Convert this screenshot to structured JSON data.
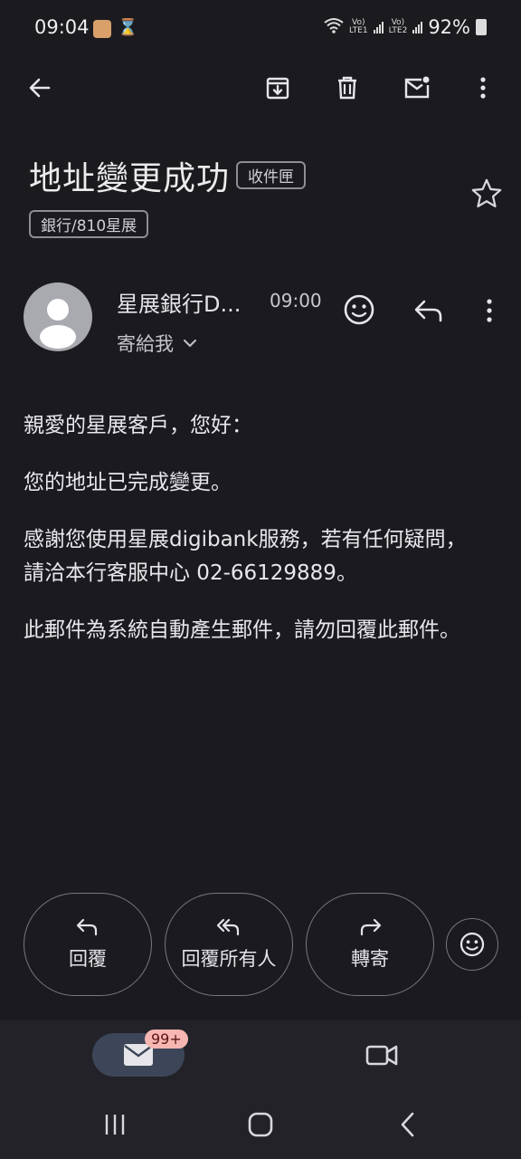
{
  "status_bar": {
    "time": "09:04",
    "sim1": "Vo)\nLTE1",
    "sim2": "Vo)\nLTE2",
    "battery": "92%"
  },
  "toolbar": {
    "back_icon": "arrow-left-icon",
    "archive_icon": "archive-icon",
    "delete_icon": "trash-icon",
    "mark_unread_icon": "mail-unread-icon",
    "more_icon": "more-vert-icon"
  },
  "email": {
    "subject": "地址變更成功",
    "folder_label": "收件匣",
    "label": "銀行/810星展",
    "sender": "星展銀行D...",
    "time": "09:00",
    "recipient": "寄給我",
    "body": [
      "親愛的星展客戶，您好：",
      "您的地址已完成變更。",
      "感謝您使用星展digibank服務，若有任何疑問，請洽本行客服中心 02-66129889。",
      "此郵件為系統自動產生郵件，請勿回覆此郵件。"
    ]
  },
  "actions": {
    "reply": "回覆",
    "reply_all": "回覆所有人",
    "forward": "轉寄"
  },
  "bottom_nav": {
    "mail_badge": "99+"
  },
  "colors": {
    "background": "#1b1b1f",
    "nav_background": "#222228",
    "active_tab": "#3c4658",
    "badge": "#f6b6b1"
  }
}
